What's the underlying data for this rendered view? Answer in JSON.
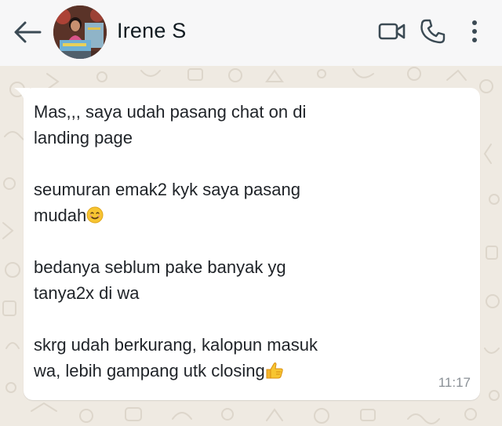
{
  "header": {
    "contact_name": "Irene S",
    "back_icon": "arrow-left-icon",
    "avatar_icon": "contact-avatar",
    "actions": [
      "video-call-icon",
      "voice-call-icon",
      "more-vertical-icon"
    ]
  },
  "message": {
    "paragraphs": [
      {
        "lines": [
          "Mas,,, saya udah pasang chat on di",
          "landing page"
        ]
      },
      {
        "lines": [
          "seumuran emak2 kyk saya pasang",
          "mudah"
        ],
        "trailing_emoji": "smiling-face-emoji"
      },
      {
        "lines": [
          "bedanya seblum pake banyak yg",
          "tanya2x di wa"
        ]
      },
      {
        "lines": [
          "skrg udah berkurang, kalopun masuk",
          "wa, lebih gampang utk closing"
        ],
        "trailing_emoji": "thumbs-up-emoji"
      }
    ],
    "time": "11:17"
  },
  "colors": {
    "header_bg": "#f7f7f8",
    "chat_bg": "#efeae2",
    "bubble_bg": "#ffffff",
    "text": "#1f2328",
    "time": "#8a9096",
    "icon": "#3b4a54"
  }
}
